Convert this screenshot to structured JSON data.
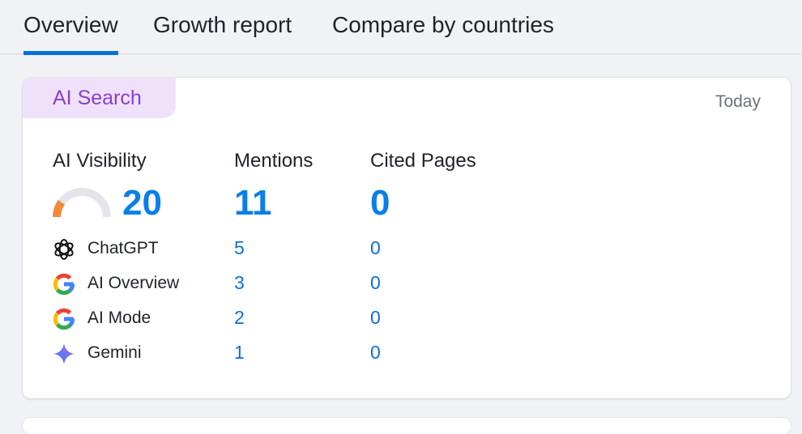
{
  "tabs": [
    {
      "label": "Overview",
      "active": true
    },
    {
      "label": "Growth report",
      "active": false
    },
    {
      "label": "Compare by countries",
      "active": false
    }
  ],
  "card": {
    "badge": "AI Search",
    "date": "Today",
    "columns": {
      "visibility": "AI Visibility",
      "mentions": "Mentions",
      "cited": "Cited Pages"
    },
    "totals": {
      "visibility": "20",
      "mentions": "11",
      "cited": "0"
    },
    "visibility_fraction": 0.2,
    "rows": [
      {
        "icon": "chatgpt-icon",
        "name": "ChatGPT",
        "mentions": "5",
        "cited": "0"
      },
      {
        "icon": "google-icon",
        "name": "AI Overview",
        "mentions": "3",
        "cited": "0"
      },
      {
        "icon": "google-icon",
        "name": "AI Mode",
        "mentions": "2",
        "cited": "0"
      },
      {
        "icon": "gemini-icon",
        "name": "Gemini",
        "mentions": "1",
        "cited": "0"
      }
    ]
  },
  "colors": {
    "accent": "#0a7fe8",
    "tab_underline": "#0a6fd6",
    "badge_bg": "#f0e1fb",
    "badge_text": "#8a3fd0",
    "gauge_fill": "#f5893b",
    "gauge_track": "#e3e5ea"
  }
}
